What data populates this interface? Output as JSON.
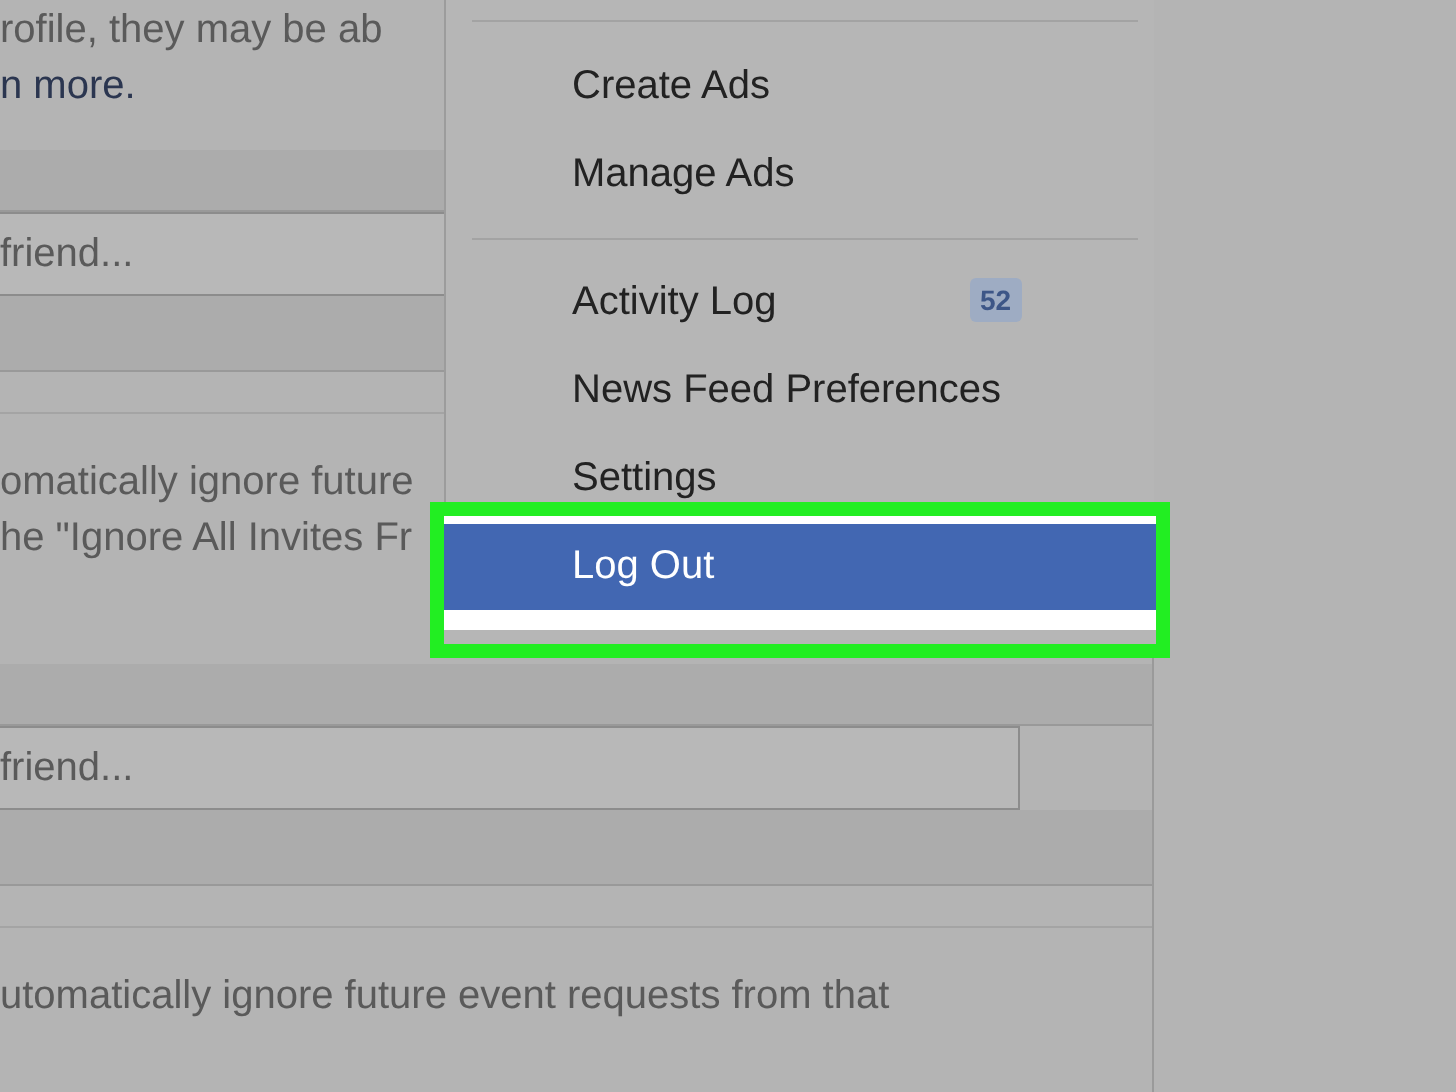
{
  "page": {
    "blocks": [
      {
        "kind": "text",
        "text": "rofile, they may be ab"
      },
      {
        "kind": "link",
        "text": "n more."
      },
      {
        "kind": "band"
      },
      {
        "kind": "field",
        "placeholder": "friend..."
      },
      {
        "kind": "band"
      },
      {
        "kind": "rule"
      },
      {
        "kind": "text",
        "text": "omatically ignore future"
      },
      {
        "kind": "text",
        "text": "he \"Ignore All Invites Fr"
      },
      {
        "kind": "band"
      },
      {
        "kind": "field",
        "placeholder": "friend..."
      },
      {
        "kind": "band"
      },
      {
        "kind": "rule"
      },
      {
        "kind": "text",
        "text": "utomatically ignore future event requests from that"
      }
    ]
  },
  "menu": {
    "groups": [
      [
        {
          "label": "Create Ads",
          "selected": false
        },
        {
          "label": "Manage Ads",
          "selected": false
        }
      ],
      [
        {
          "label": "Activity Log",
          "badge": "52",
          "selected": false
        },
        {
          "label": "News Feed Preferences",
          "selected": false
        },
        {
          "label": "Settings",
          "selected": false
        },
        {
          "label": "Log Out",
          "selected": true
        }
      ]
    ]
  }
}
